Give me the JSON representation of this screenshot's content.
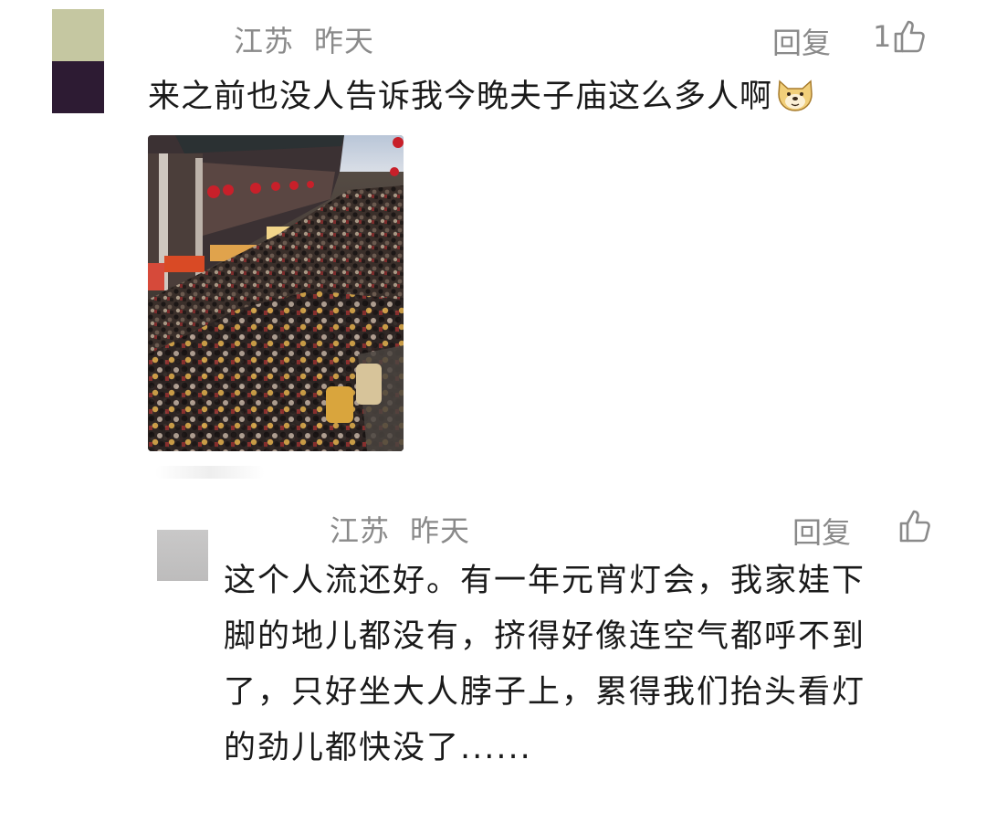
{
  "main_comment": {
    "location": "江苏",
    "time": "昨天",
    "reply_label": "回复",
    "like_count": "1",
    "text": "来之前也没人告诉我今晚夫子庙这么多人啊",
    "emoji": "dog-face-emoji",
    "photo": "crowded-street-photo"
  },
  "reply_comment": {
    "location": "江苏",
    "time": "昨天",
    "reply_label": "回复",
    "text_lines": [
      "这个人流还好。有一年元宵灯会，我家娃下",
      "脚的地儿都没有，挤得好像连空气都呼不到",
      "了，只好坐大人脖子上，累得我们抬头看灯",
      "的劲儿都快没了......"
    ]
  },
  "icons": {
    "like": "thumbs-up-icon"
  },
  "colors": {
    "meta_text": "#8a8a8a",
    "body_text": "#1a1a1a"
  }
}
